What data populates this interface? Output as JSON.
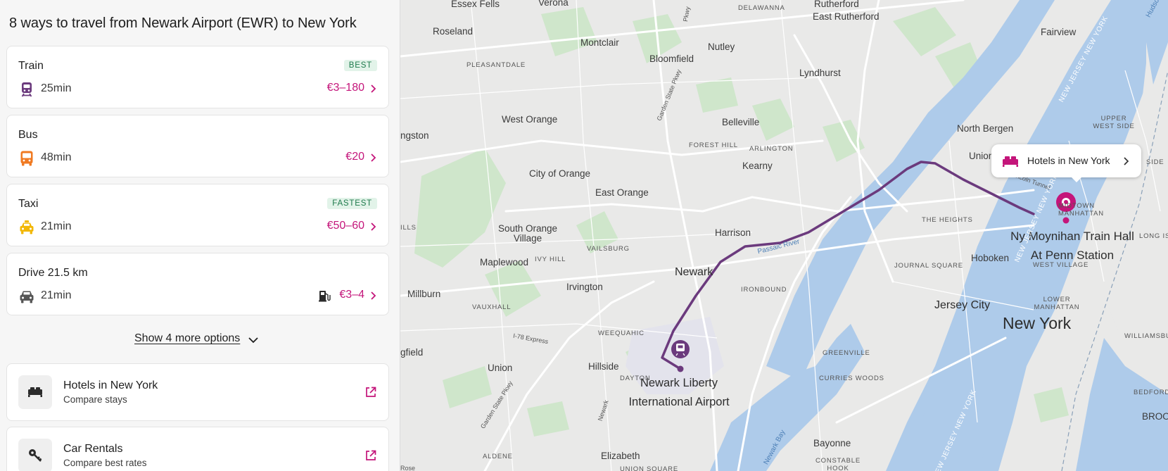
{
  "panel": {
    "title": "8 ways to travel from Newark Airport (EWR) to New York",
    "options": [
      {
        "mode": "Train",
        "icon": "train-icon",
        "duration": "25min",
        "price": "€3–180",
        "badge": "BEST"
      },
      {
        "mode": "Bus",
        "icon": "bus-icon",
        "duration": "48min",
        "price": "€20",
        "badge": ""
      },
      {
        "mode": "Taxi",
        "icon": "taxi-icon",
        "duration": "21min",
        "price": "€50–60",
        "badge": "FASTEST"
      },
      {
        "mode": "Drive 21.5 km",
        "icon": "car-icon",
        "duration": "21min",
        "price": "€3–4",
        "badge": "",
        "extra_icon": "fuel-icon"
      }
    ],
    "more_label": "Show 4 more options",
    "links": [
      {
        "title": "Hotels in New York",
        "subtitle": "Compare stays",
        "icon": "bed-icon"
      },
      {
        "title": "Car Rentals",
        "subtitle": "Compare best rates",
        "icon": "key-icon"
      }
    ]
  },
  "map": {
    "labels": {
      "essex_fells": "Essex Fells",
      "verona": "Verona",
      "delawanna": "DELAWANNA",
      "rutherford": "Rutherford",
      "east_rutherford": "East Rutherford",
      "roseland": "Roseland",
      "montclair": "Montclair",
      "nutley": "Nutley",
      "fairview": "Fairview",
      "pleasantdale": "PLEASANTDALE",
      "bloomfield": "Bloomfield",
      "lyndhurst": "Lyndhurst",
      "west_orange": "West Orange",
      "belleville": "Belleville",
      "north_bergen": "North Bergen",
      "upper_west_side": "UPPER WEST SIDE",
      "livingston": "ngston",
      "forest_hill": "FOREST HILL",
      "arlington": "ARLINGTON",
      "union_city": "Union",
      "kearny": "Kearny",
      "city_of_orange": "City of Orange",
      "east_orange": "East Orange",
      "the_heights": "THE HEIGHTS",
      "south_orange": "South Orange Village",
      "ills": "ILLS",
      "harrison": "Harrison",
      "vailsburg": "VAILSBURG",
      "hoboken": "Hoboken",
      "maplewood": "Maplewood",
      "ivy_hill": "IVY HILL",
      "journal_square": "JOURNAL SQUARE",
      "west_village": "WEST VILLAGE",
      "newark": "Newark",
      "midtown": "MIDTOWN MANHATTAN",
      "moynihan": "Ny Moynihan Train Hall At Penn Station",
      "millburn": "Millburn",
      "irvington": "Irvington",
      "ironbound": "IRONBOUND",
      "jersey_city": "Jersey City",
      "lower_manhattan": "LOWER MANHATTAN",
      "vauxhall": "VAUXHALL",
      "new_york": "New York",
      "weequahic": "WEEQUAHIC",
      "williamsburg": "WILLIAMSBURG",
      "i78": "I-78 Express",
      "springfield": "gfield",
      "greenville": "GREENVILLE",
      "union": "Union",
      "hillside": "Hillside",
      "dayton": "DAYTON",
      "newark_airport": "Newark Liberty International Airport",
      "curries_woods": "CURRIES WOODS",
      "bedford": "BEDFORD-",
      "broo": "BROO",
      "long_island": "LONG ISL",
      "side": "SIDE",
      "elizabeth": "Elizabeth",
      "aldene": "ALDENE",
      "union_square": "UNION SQUARE",
      "bayonne": "Bayonne",
      "constable_hook": "CONSTABLE HOOK",
      "newark_bay": "Newark Bay",
      "passaic_river": "Passaic River",
      "lincoln_tunnel": "Lincoln Tunnel",
      "garden_state_pkwy_1": "Garden State Pkwy",
      "garden_state_pkwy_2": "Garden State Pkwy",
      "newark_ave": "Newark",
      "nj_ny_1": "NEW JERSEY NEW YORK",
      "nj_ny_2": "NEW JERSEY NEW YORK",
      "nj_ny_3": "NEW JERSEY NEW YORK",
      "hudson": "Hudso",
      "pkwy": "Pkwy",
      "roselle": "Rose"
    },
    "hotel_popup": "Hotels in New York",
    "route_color": "#6b3a7d",
    "accent_color": "#c4157a"
  }
}
